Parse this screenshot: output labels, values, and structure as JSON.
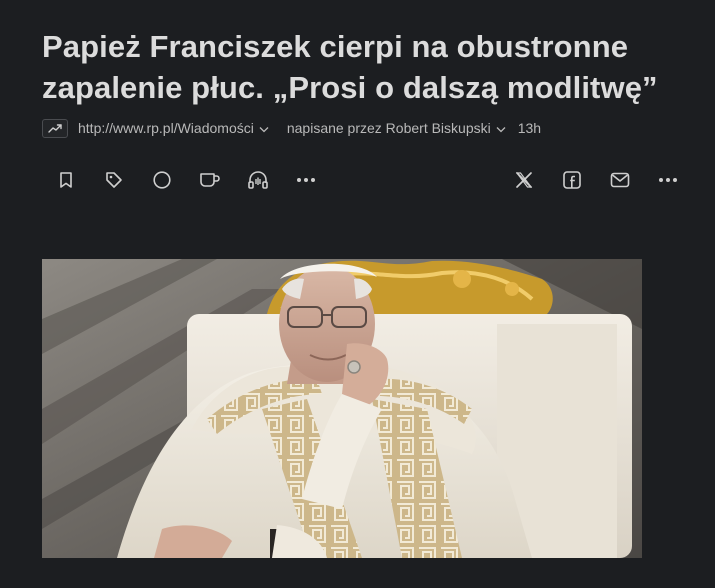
{
  "article": {
    "title": "Papież Franciszek cierpi na obustronne zapalenie płuc. „Prosi o dalszą modlitwę”",
    "source_url": "http://www.rp.pl/Wiadomości",
    "author": "napisane przez Robert Biskupski",
    "time_ago": "13h"
  },
  "toolbar": {
    "left_icons": [
      "bookmark-icon",
      "tag-icon",
      "circle-icon",
      "mug-icon",
      "headphones-icon",
      "more-icon"
    ],
    "right_icons": [
      "x-icon",
      "facebook-icon",
      "mail-icon",
      "more-icon"
    ]
  },
  "image": {
    "subject": "photo-of-pope"
  },
  "colors": {
    "background": "#1c1e21",
    "title": "#dcdcdc",
    "meta": "#b9b9b9",
    "icon": "#cfcfcf"
  }
}
